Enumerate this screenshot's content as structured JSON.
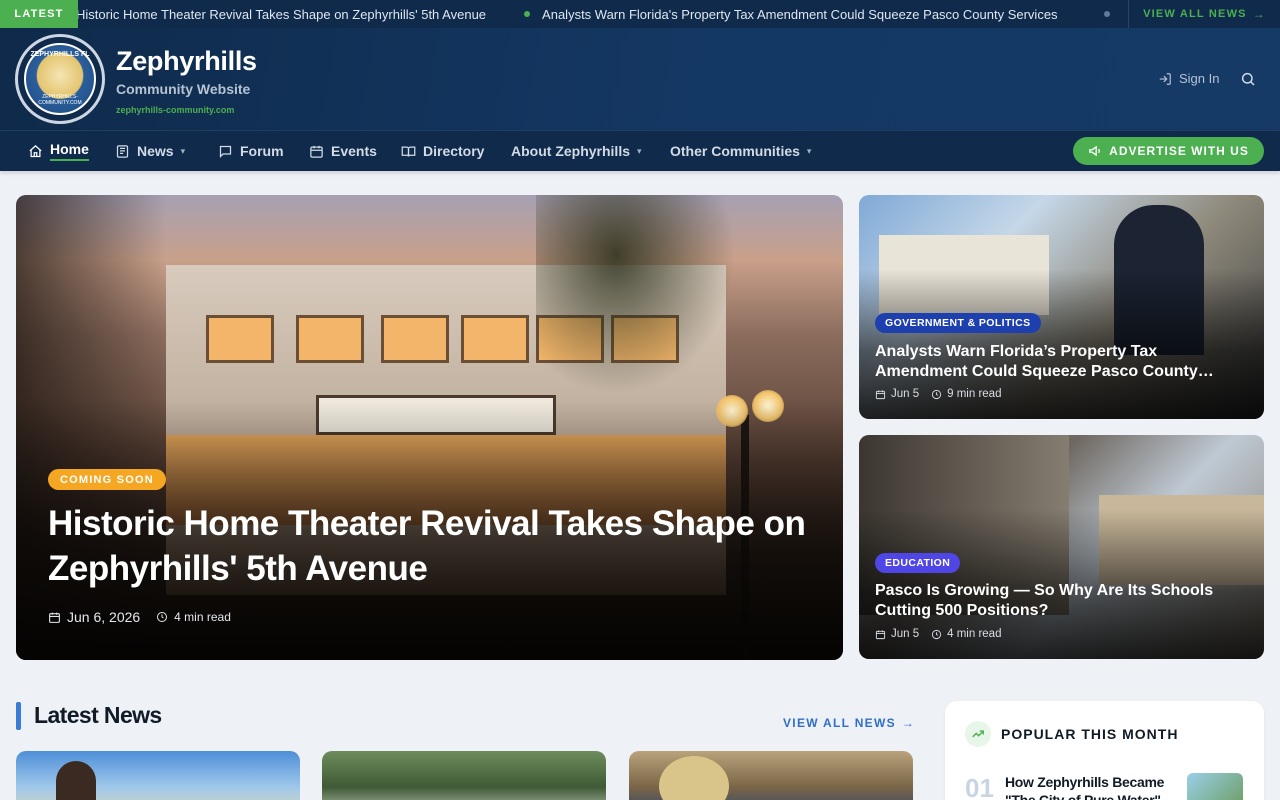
{
  "ticker": {
    "badge": "LATEST",
    "items": [
      "Historic Home Theater Revival Takes Shape on Zephyrhills' 5th Avenue",
      "Analysts Warn Florida's Property Tax Amendment Could Squeeze Pasco County Services"
    ],
    "view_all": "VIEW ALL NEWS"
  },
  "header": {
    "logo_top": "ZEPHYRHILLS FL",
    "logo_bottom": "ZEPHYRHILLS-COMMUNITY.COM",
    "site_name": "Zephyrhills",
    "site_sub": "Community Website",
    "site_url": "zephyrhills-community.com",
    "signin": "Sign In"
  },
  "nav": {
    "items": [
      {
        "label": "Home",
        "icon": "home-icon"
      },
      {
        "label": "News",
        "icon": "newspaper-icon"
      },
      {
        "label": "Forum",
        "icon": "chat-icon"
      },
      {
        "label": "Events",
        "icon": "calendar-icon"
      },
      {
        "label": "Directory",
        "icon": "book-icon"
      },
      {
        "label": "About Zephyrhills",
        "icon": ""
      },
      {
        "label": "Other Communities",
        "icon": ""
      }
    ],
    "advertise": "ADVERTISE WITH US"
  },
  "hero": {
    "tag": "COMING SOON",
    "title": "Historic Home Theater Revival Takes Shape on Zephyrhills' 5th Avenue",
    "date": "Jun 6, 2026",
    "read": "4 min read"
  },
  "side_cards": [
    {
      "tag": "GOVERNMENT & POLITICS",
      "title_line1": "Analysts Warn Florida’s Property Tax",
      "title_line2": "Amendment Could Squeeze Pasco County…",
      "date": "Jun 5",
      "read": "9 min read"
    },
    {
      "tag": "EDUCATION",
      "title_line1": "Pasco Is Growing — So Why Are Its Schools",
      "title_line2": "Cutting 500 Positions?",
      "date": "Jun 5",
      "read": "4 min read"
    }
  ],
  "latest": {
    "title": "Latest News",
    "view_all": "VIEW ALL NEWS"
  },
  "popular": {
    "title": "POPULAR THIS MONTH",
    "num": "01",
    "item": "How Zephyrhills Became \"The City of Pure Water\""
  },
  "colors": {
    "navy": "#0f2a4a",
    "green": "#4caf50",
    "orange": "#f5a623",
    "blue_tag": "#1e40af",
    "indigo_tag": "#4f46e5"
  }
}
